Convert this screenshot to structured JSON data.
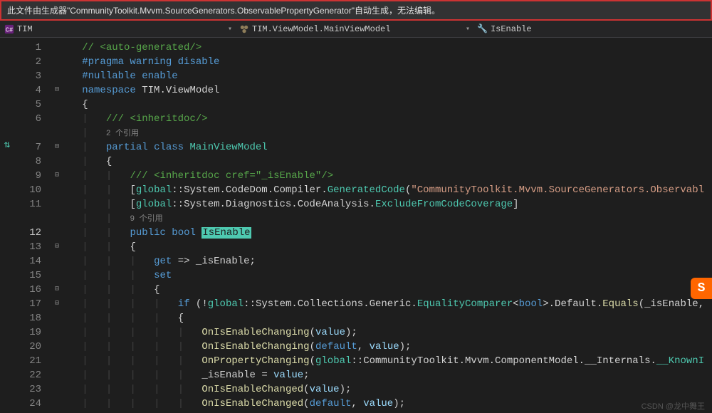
{
  "infoBar": {
    "message": "此文件由生成器\"CommunityToolkit.Mvvm.SourceGenerators.ObservablePropertyGenerator\"自动生成，无法编辑。"
  },
  "breadcrumb": {
    "project": "TIM",
    "class": "TIM.ViewModel.MainViewModel",
    "member": "IsEnable"
  },
  "watermark": "CSDN @龙中舞王",
  "code": {
    "currentLine": 12,
    "lines": [
      {
        "n": 1,
        "html": "   <span class='comment'>// &lt;auto-generated/&gt;</span>"
      },
      {
        "n": 2,
        "html": "   <span class='keyword'>#pragma warning disable</span>"
      },
      {
        "n": 3,
        "html": "   <span class='keyword'>#nullable enable</span>"
      },
      {
        "n": 4,
        "fold": "⊟",
        "html": "   <span class='keyword'>namespace</span> TIM.ViewModel"
      },
      {
        "n": 5,
        "html": "   {"
      },
      {
        "n": 6,
        "html": "   <span class='guide'>|</span>   <span class='comment'>/// &lt;inheritdoc/&gt;</span>"
      },
      {
        "n": null,
        "html": "   <span class='guide'>|</span>   <span class='ref'>2 个引用</span>"
      },
      {
        "n": 7,
        "fold": "⊟",
        "html": "   <span class='guide'>|</span>   <span class='keyword'>partial</span> <span class='keyword'>class</span> <span class='type'>MainViewModel</span>"
      },
      {
        "n": 8,
        "html": "   <span class='guide'>|</span>   {"
      },
      {
        "n": 9,
        "fold": "⊟",
        "html": "   <span class='guide'>|</span>   <span class='guide'>|</span>   <span class='comment'>/// &lt;inheritdoc cref=\"_isEnable\"/&gt;</span>"
      },
      {
        "n": 10,
        "html": "   <span class='guide'>|</span>   <span class='guide'>|</span>   [<span class='type'>global</span>::System.CodeDom.Compiler.<span class='type'>GeneratedCode</span>(<span class='string'>\"CommunityToolkit.Mvvm.SourceGenerators.Observabl</span>"
      },
      {
        "n": 11,
        "html": "   <span class='guide'>|</span>   <span class='guide'>|</span>   [<span class='type'>global</span>::System.Diagnostics.CodeAnalysis.<span class='type'>ExcludeFromCodeCoverage</span>]"
      },
      {
        "n": null,
        "html": "   <span class='guide'>|</span>   <span class='guide'>|</span>   <span class='ref'>9 个引用</span>"
      },
      {
        "n": 12,
        "current": true,
        "html": "   <span class='guide'>|</span>   <span class='guide'>|</span>   <span class='keyword'>public</span> <span class='keyword'>bool</span> <span class='highlight'>IsEnable</span>"
      },
      {
        "n": 13,
        "fold": "⊟",
        "html": "   <span class='guide'>|</span>   <span class='guide'>|</span>   {"
      },
      {
        "n": 14,
        "html": "   <span class='guide'>|</span>   <span class='guide'>|</span>   <span class='guide'>|</span>   <span class='keyword'>get</span> =&gt; _isEnable;"
      },
      {
        "n": 15,
        "html": "   <span class='guide'>|</span>   <span class='guide'>|</span>   <span class='guide'>|</span>   <span class='keyword'>set</span>"
      },
      {
        "n": 16,
        "fold": "⊟",
        "html": "   <span class='guide'>|</span>   <span class='guide'>|</span>   <span class='guide'>|</span>   {"
      },
      {
        "n": 17,
        "fold": "⊟",
        "html": "   <span class='guide'>|</span>   <span class='guide'>|</span>   <span class='guide'>|</span>   <span class='guide'>|</span>   <span class='keyword'>if</span> (!<span class='type'>global</span>::System.Collections.Generic.<span class='type'>EqualityComparer</span>&lt;<span class='keyword'>bool</span>&gt;.Default.<span class='method'>Equals</span>(_isEnable,"
      },
      {
        "n": 18,
        "html": "   <span class='guide'>|</span>   <span class='guide'>|</span>   <span class='guide'>|</span>   <span class='guide'>|</span>   {"
      },
      {
        "n": 19,
        "html": "   <span class='guide'>|</span>   <span class='guide'>|</span>   <span class='guide'>|</span>   <span class='guide'>|</span>   <span class='guide'>|</span>   <span class='method'>OnIsEnableChanging</span>(<span class='param'>value</span>);"
      },
      {
        "n": 20,
        "html": "   <span class='guide'>|</span>   <span class='guide'>|</span>   <span class='guide'>|</span>   <span class='guide'>|</span>   <span class='guide'>|</span>   <span class='method'>OnIsEnableChanging</span>(<span class='keyword'>default</span>, <span class='param'>value</span>);"
      },
      {
        "n": 21,
        "html": "   <span class='guide'>|</span>   <span class='guide'>|</span>   <span class='guide'>|</span>   <span class='guide'>|</span>   <span class='guide'>|</span>   <span class='method'>OnPropertyChanging</span>(<span class='type'>global</span>::CommunityToolkit.Mvvm.ComponentModel.__Internals.<span class='type'>__KnownI</span>"
      },
      {
        "n": 22,
        "html": "   <span class='guide'>|</span>   <span class='guide'>|</span>   <span class='guide'>|</span>   <span class='guide'>|</span>   <span class='guide'>|</span>   _isEnable = <span class='param'>value</span>;"
      },
      {
        "n": 23,
        "html": "   <span class='guide'>|</span>   <span class='guide'>|</span>   <span class='guide'>|</span>   <span class='guide'>|</span>   <span class='guide'>|</span>   <span class='method'>OnIsEnableChanged</span>(<span class='param'>value</span>);"
      },
      {
        "n": 24,
        "html": "   <span class='guide'>|</span>   <span class='guide'>|</span>   <span class='guide'>|</span>   <span class='guide'>|</span>   <span class='guide'>|</span>   <span class='method'>OnIsEnableChanged</span>(<span class='keyword'>default</span>, <span class='param'>value</span>);"
      }
    ]
  }
}
